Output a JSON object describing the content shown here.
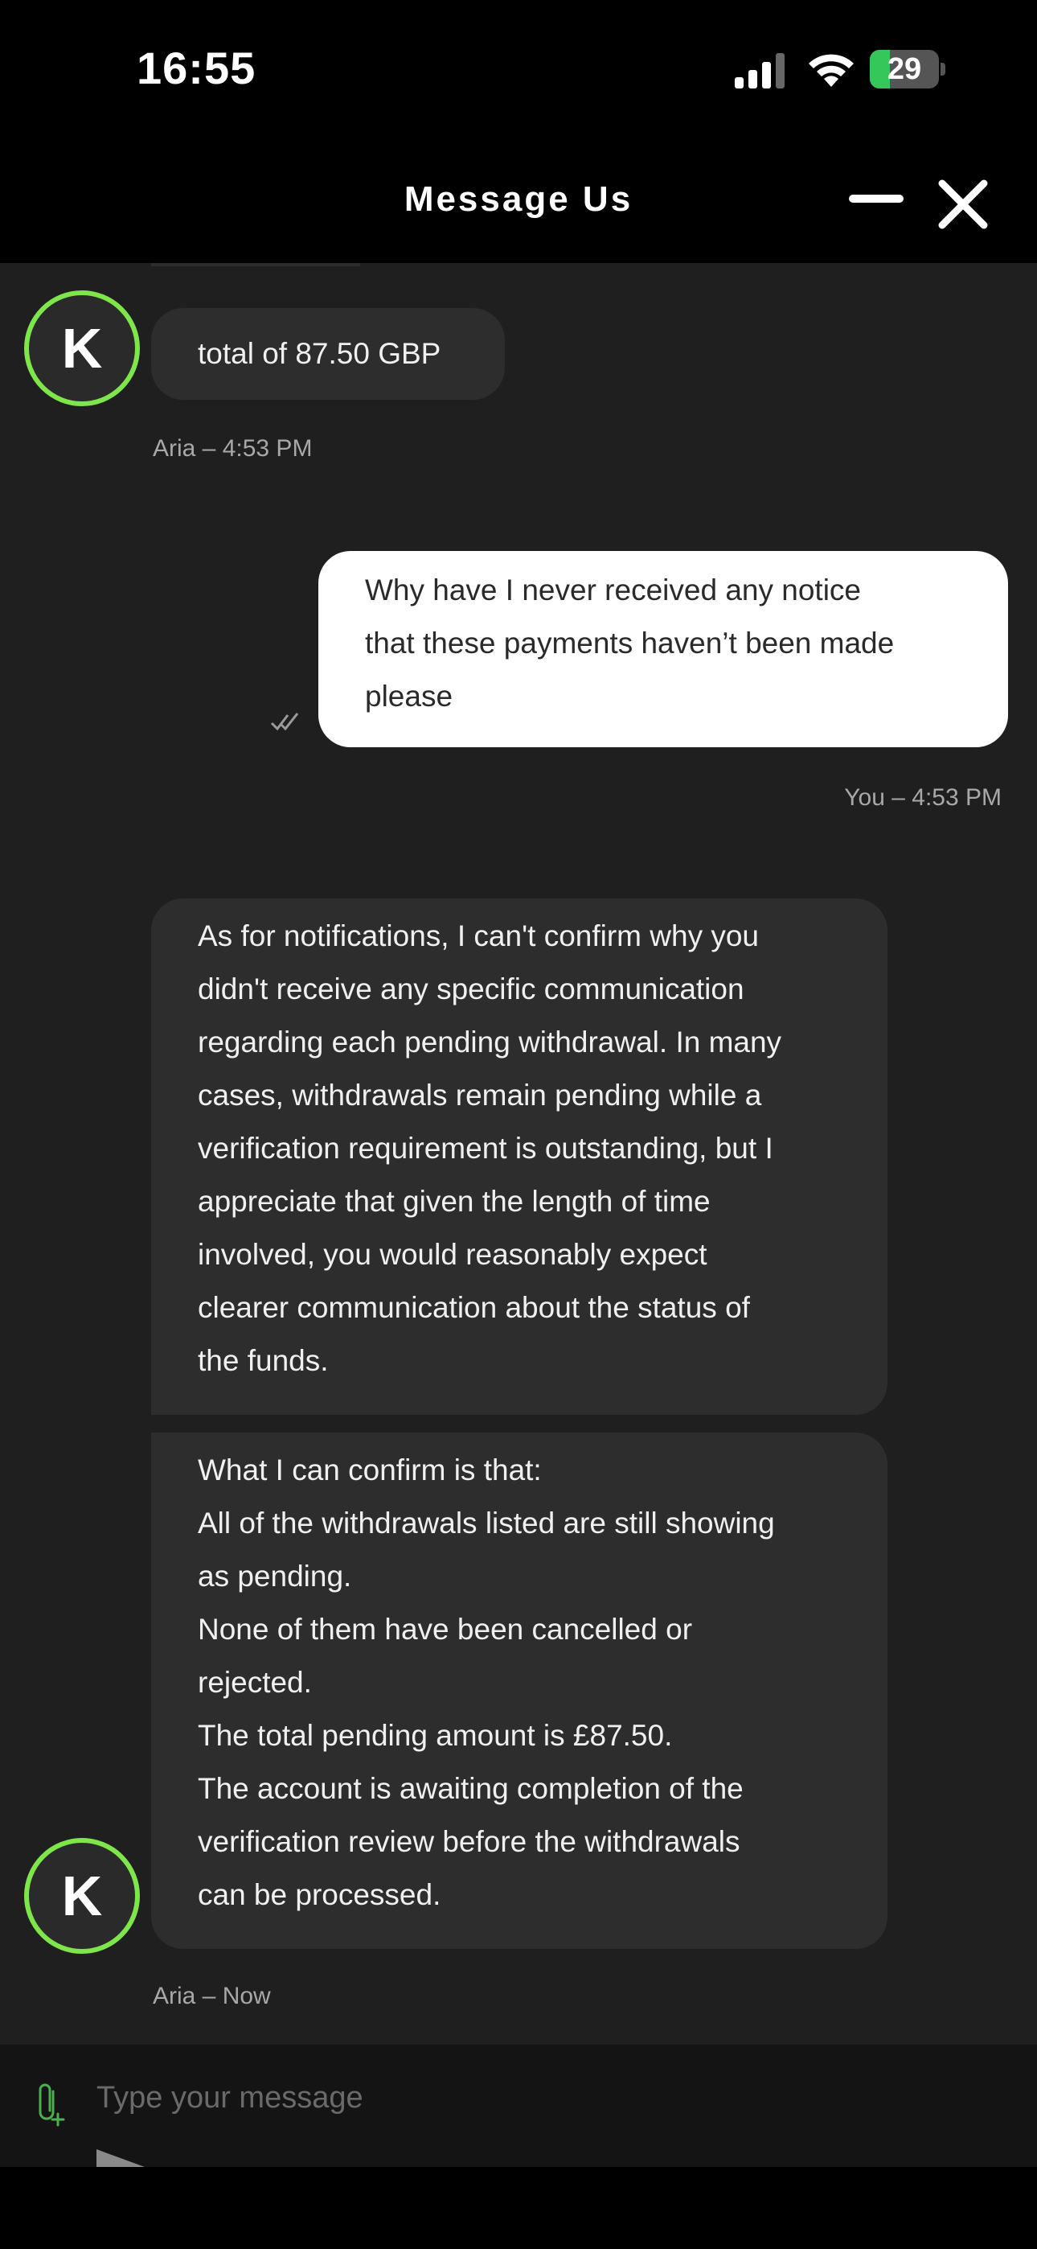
{
  "status_bar": {
    "time": "16:55",
    "battery_level": "29",
    "battery_fraction": 0.29,
    "icons": [
      "cellular-signal-icon",
      "wifi-icon",
      "battery-charging-icon"
    ]
  },
  "header": {
    "title": "Message Us",
    "icons": [
      "minimize-icon",
      "close-icon"
    ]
  },
  "messages": [
    {
      "sender": "agent",
      "avatar_initial": "K",
      "lines": [
        "total of 87.50 GBP"
      ]
    },
    {
      "sender": "agent_meta",
      "meta": "Aria – 4:53 PM"
    },
    {
      "sender": "user",
      "lines": [
        "Why have I never received any notice",
        "that these payments haven’t been made",
        "please"
      ],
      "meta": "You – 4:53 PM",
      "status_icon": "double-check-icon"
    },
    {
      "sender": "agent",
      "lines": [
        "As for notifications, I can't confirm why you",
        "didn't receive any specific communication",
        "regarding each pending withdrawal. In many",
        "cases, withdrawals remain pending while a",
        "verification requirement is outstanding, but I",
        "appreciate that given the length of time",
        "involved, you would reasonably expect",
        "clearer communication about the status of",
        "the funds."
      ]
    },
    {
      "sender": "agent",
      "avatar_initial": "K",
      "lines": [
        "What I can confirm is that:",
        "All of the withdrawals listed are still showing",
        "as pending.",
        "None of them have been cancelled or",
        "rejected.",
        "The total pending amount is £87.50.",
        "The account is awaiting completion of the",
        "verification review before the withdrawals",
        "can be processed."
      ],
      "meta": "Aria – Now"
    }
  ],
  "composer": {
    "placeholder": "Type your message",
    "icons": [
      "attachment-icon",
      "send-icon"
    ]
  },
  "colors": {
    "accent_green": "#7ee54a",
    "chat_background": "#1f1f1f",
    "agent_bubble": "#2d2d2d",
    "user_bubble": "#ffffff"
  }
}
